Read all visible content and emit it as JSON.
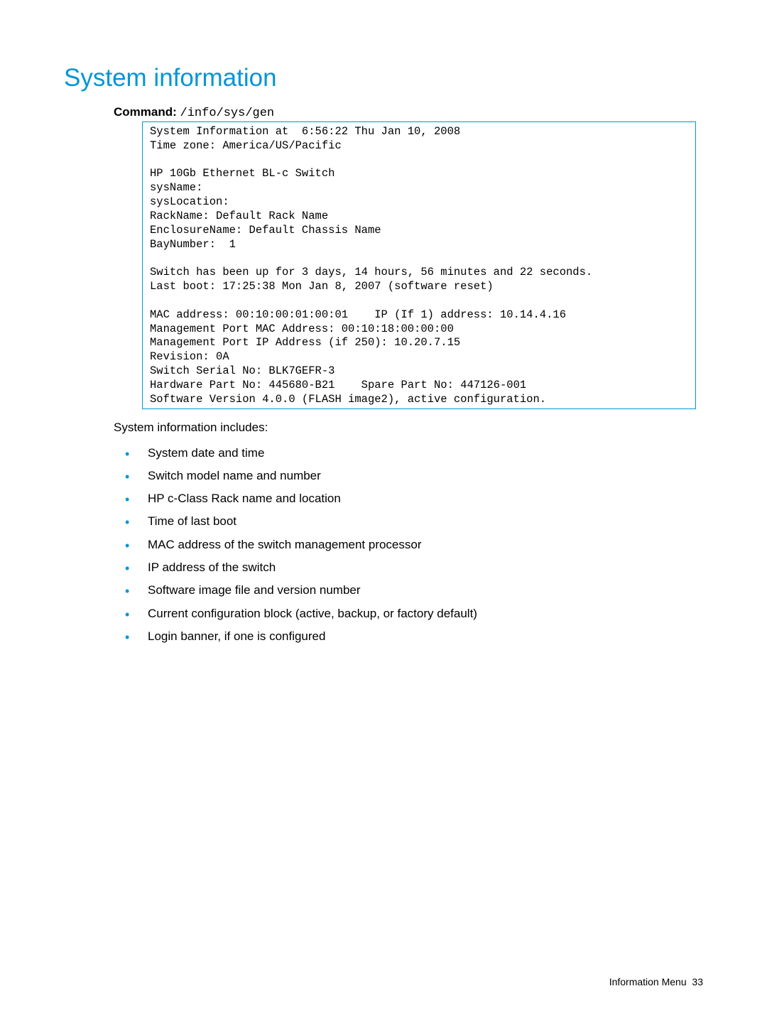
{
  "heading": "System information",
  "command": {
    "label": "Command:",
    "text": "/info/sys/gen"
  },
  "output_lines": [
    "System Information at  6:56:22 Thu Jan 10, 2008",
    "Time zone: America/US/Pacific",
    "",
    "HP 10Gb Ethernet BL-c Switch",
    "sysName:",
    "sysLocation:",
    "RackName: Default Rack Name",
    "EnclosureName: Default Chassis Name",
    "BayNumber:  1",
    "",
    "Switch has been up for 3 days, 14 hours, 56 minutes and 22 seconds.",
    "Last boot: 17:25:38 Mon Jan 8, 2007 (software reset)",
    "",
    "MAC address: 00:10:00:01:00:01    IP (If 1) address: 10.14.4.16",
    "Management Port MAC Address: 00:10:18:00:00:00",
    "Management Port IP Address (if 250): 10.20.7.15",
    "Revision: 0A",
    "Switch Serial No: BLK7GEFR-3",
    "Hardware Part No: 445680-B21    Spare Part No: 447126-001",
    "Software Version 4.0.0 (FLASH image2), active configuration."
  ],
  "intro": "System information includes:",
  "bullets": [
    "System date and time",
    "Switch model name and number",
    "HP c-Class Rack name and location",
    "Time of last boot",
    "MAC address of the switch management processor",
    "IP address of the switch",
    "Software image file and version number",
    "Current configuration block (active, backup, or factory default)",
    "Login banner, if one is configured"
  ],
  "footer": {
    "section": "Information Menu",
    "page": "33"
  }
}
